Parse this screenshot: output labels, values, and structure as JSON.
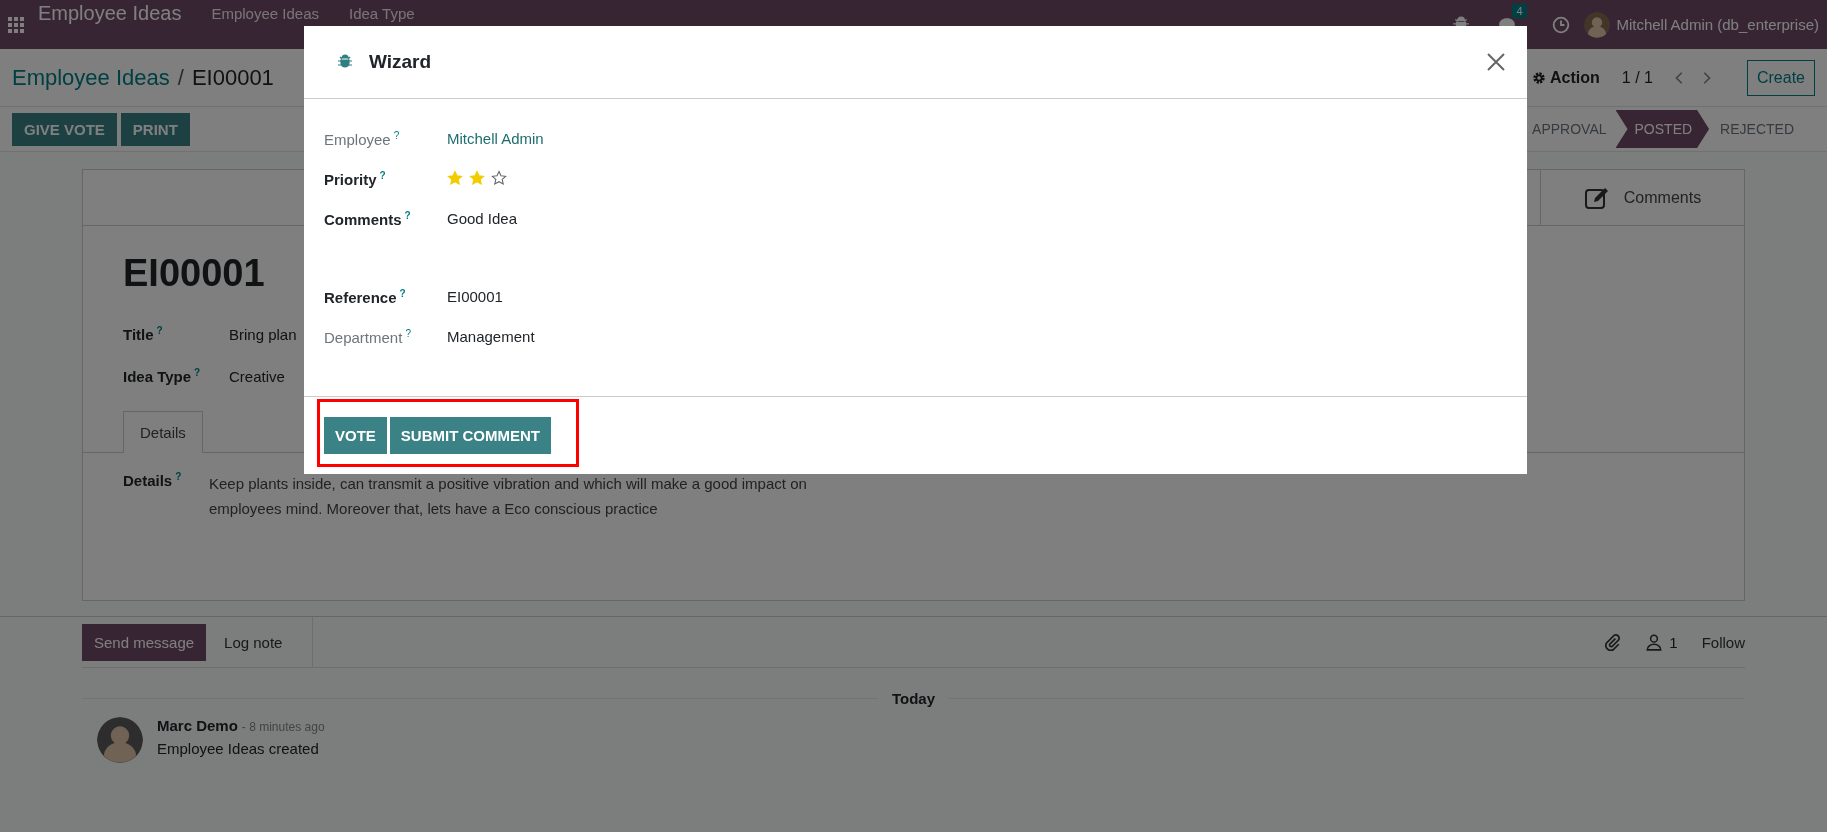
{
  "navbar": {
    "app_name": "Employee Ideas",
    "menus": [
      {
        "label": "Employee Ideas"
      },
      {
        "label": "Idea Type"
      }
    ],
    "message_count": "4",
    "user": "Mitchell Admin (db_enterprise)"
  },
  "control_panel": {
    "breadcrumbs": [
      {
        "label": "Employee Ideas"
      },
      {
        "label": "EI00001"
      }
    ],
    "separator": "/",
    "action": "Action",
    "pager": "1 / 1",
    "create": "Create",
    "buttons": [
      {
        "label": "GIVE VOTE"
      },
      {
        "label": "PRINT"
      }
    ],
    "stages": [
      {
        "label": "APPROVAL",
        "selected": false
      },
      {
        "label": "POSTED",
        "selected": true
      },
      {
        "label": "REJECTED",
        "selected": false
      }
    ]
  },
  "form": {
    "smart_buttons": [
      {
        "label": "Comments"
      }
    ],
    "reference": "EI00001",
    "fields": [
      {
        "label": "Title$^{?}$",
        "value": "Bring plan"
      },
      {
        "label": "Idea Type$^{?}$",
        "value": "Creative"
      }
    ],
    "tabs": [
      {
        "label": "Details",
        "selected": true
      }
    ],
    "details": {
      "label": "Details$^{?}$",
      "text": "Keep plants inside, can transmit a positive vibration and which will make a good impact on employees mind. Moreover that, lets have a Eco conscious practice"
    }
  },
  "chatter": {
    "buttons": [
      {
        "label": "Send message",
        "selected": true
      },
      {
        "label": "Log note",
        "selected": false
      }
    ],
    "follower_count": "1",
    "follow": "Follow",
    "date_separator": "Today",
    "messages": [
      {
        "author": "Marc Demo",
        "time": "- 8 minutes ago",
        "body": "Employee Ideas created"
      }
    ]
  },
  "wizard": {
    "title": "Wizard",
    "fields": [
      {
        "label": "Employee$^{?}$",
        "readonly": true,
        "kind": "link",
        "value": "Mitchell Admin"
      },
      {
        "label": "Priority$^{?}$",
        "readonly": false,
        "kind": "stars",
        "stars": 2
      },
      {
        "label": "Comments$^{?}$",
        "readonly": false,
        "kind": "textarea",
        "value": "Good Idea"
      },
      {
        "label": "Reference$^{?}$",
        "readonly": false,
        "kind": "text",
        "value": "EI00001"
      },
      {
        "label": "Department$^{?}$",
        "readonly": true,
        "kind": "text",
        "value": "Management"
      }
    ],
    "buttons": [
      {
        "label": "VOTE"
      },
      {
        "label": "SUBMIT COMMENT"
      }
    ],
    "highlighted": true
  }
}
